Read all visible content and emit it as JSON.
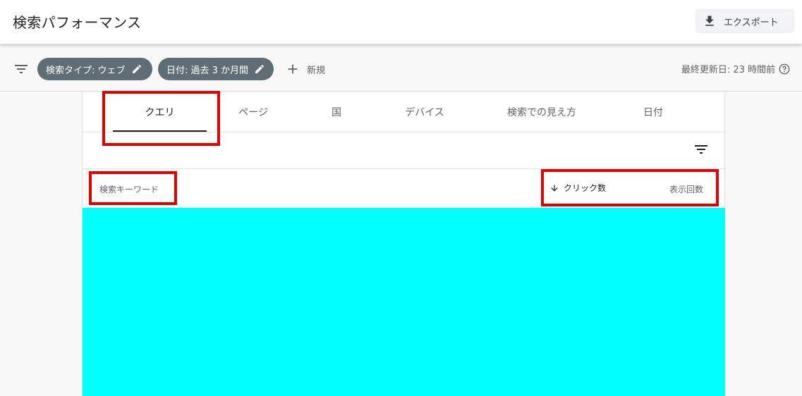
{
  "header": {
    "title": "検索パフォーマンス",
    "export_label": "エクスポート"
  },
  "filters": {
    "chips": [
      "検索タイプ: ウェブ",
      "日付: 過去 3 か月間"
    ],
    "add_label": "新規",
    "last_updated": "最終更新日: 23 時間前"
  },
  "tabs": [
    "クエリ",
    "ページ",
    "国",
    "デバイス",
    "検索での見え方",
    "日付"
  ],
  "active_tab": 0,
  "table": {
    "columns": {
      "keyword": "検索キーワード",
      "clicks": "クリック数",
      "impressions": "表示回数"
    },
    "sort": "clicks-desc"
  },
  "colors": {
    "chip_bg": "#5f6e75",
    "redaction": "#00ffff",
    "annotation": "#e50000"
  }
}
